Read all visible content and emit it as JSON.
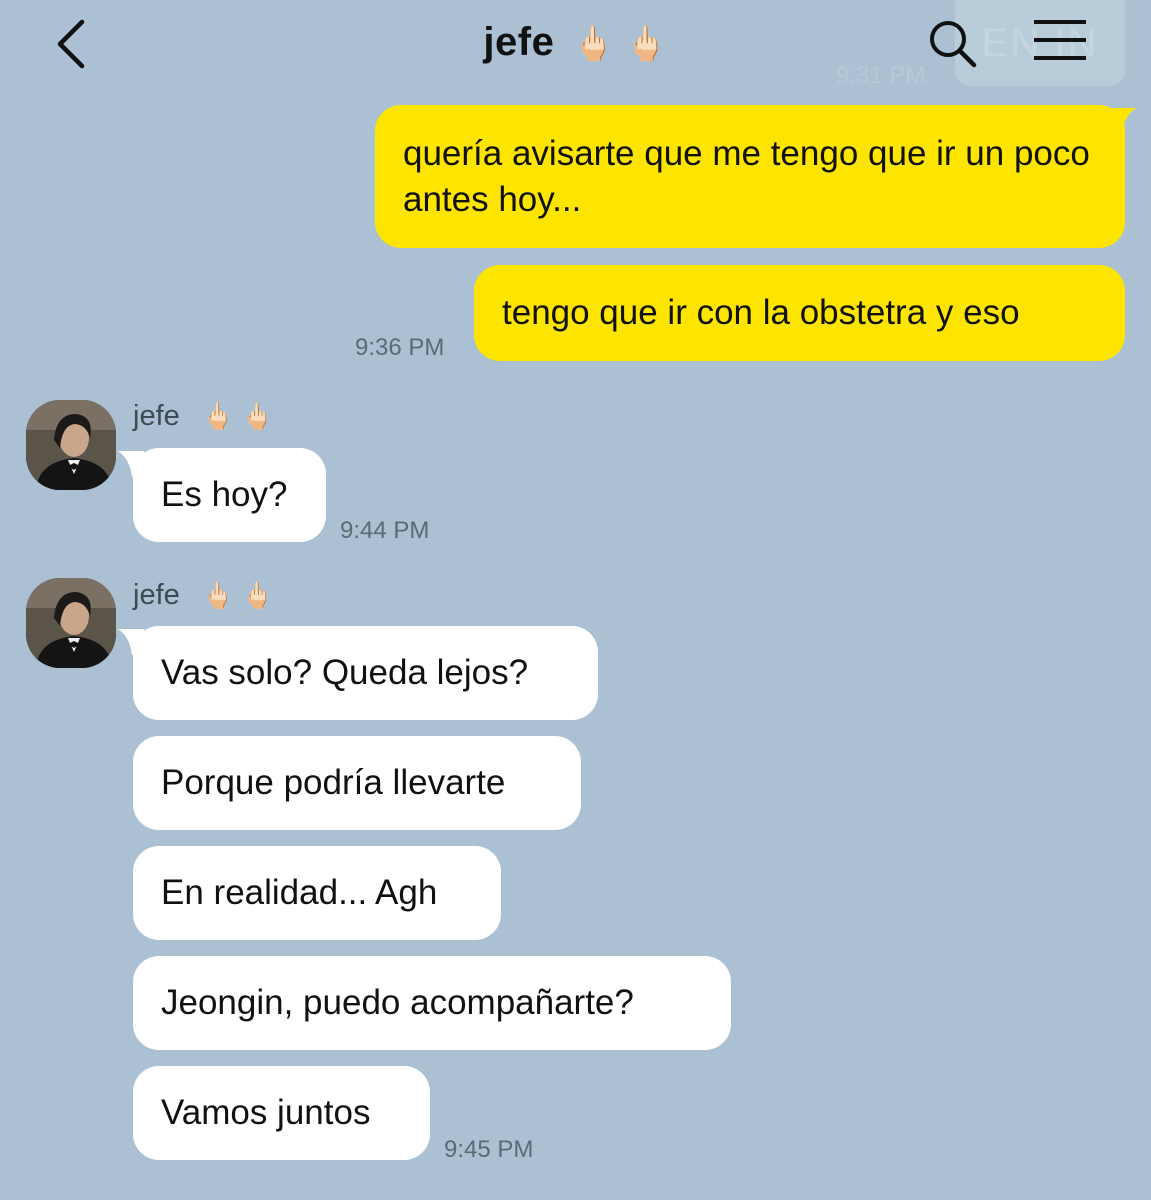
{
  "header": {
    "title": "jefe",
    "title_emoji": "🖕🏻 🖕🏻",
    "badge_text": "EN  IN",
    "faded_time": "9:31 PM",
    "icons": {
      "back": "chevron-left-icon",
      "search": "search-icon",
      "menu": "hamburger-menu-icon"
    }
  },
  "messages_out": [
    {
      "text": "quería avisarte que me tengo que ir un poco antes hoy..."
    },
    {
      "text": "tengo que ir con la obstetra y eso",
      "time": "9:36 PM"
    }
  ],
  "group1": {
    "sender": "jefe",
    "sender_emoji": "🖕🏻 🖕🏻",
    "messages": [
      {
        "text": "Es hoy?"
      }
    ],
    "time": "9:44 PM"
  },
  "group2": {
    "sender": "jefe",
    "sender_emoji": "🖕🏻 🖕🏻",
    "messages": [
      {
        "text": "Vas solo? Queda lejos?"
      },
      {
        "text": "Porque podría llevarte"
      },
      {
        "text": "En realidad... Agh"
      },
      {
        "text": "Jeongin, puedo acompañarte?"
      },
      {
        "text": "Vamos juntos"
      }
    ],
    "time": "9:45 PM"
  },
  "colors": {
    "background": "#abc1d3",
    "outgoing_bubble": "#fee500",
    "incoming_bubble": "#ffffff",
    "timestamp": "#5c6a74"
  }
}
